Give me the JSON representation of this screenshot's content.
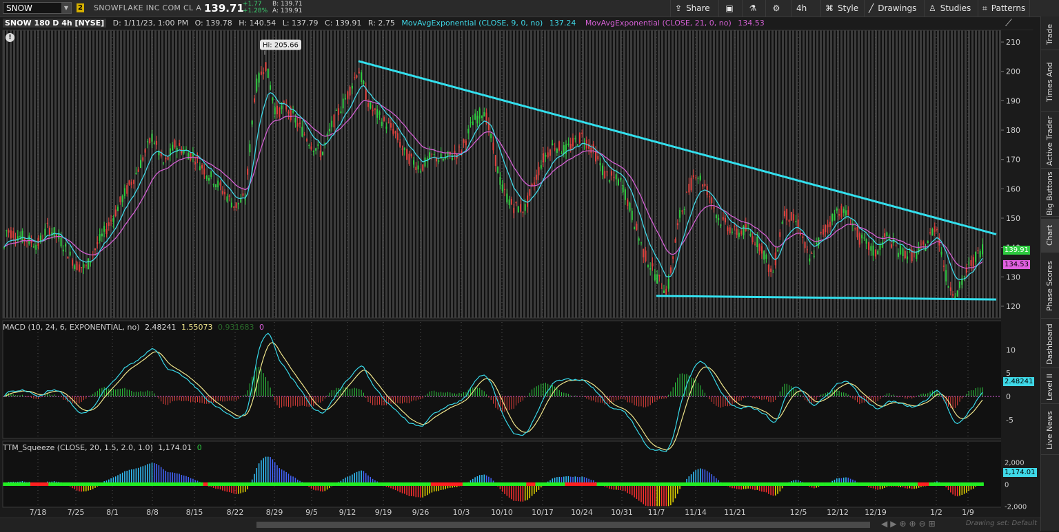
{
  "toolbar": {
    "symbol": "SNOW",
    "link_badge": "2",
    "company": "SNOWFLAKE INC COM CL A",
    "last": "139.71",
    "change": "+1.77",
    "change_pct": "+1.28%",
    "bid": "B: 139.71",
    "ask": "A: 139.91",
    "share": "Share",
    "interval": "4h",
    "style": "Style",
    "drawings": "Drawings",
    "studies": "Studies",
    "patterns": "Patterns"
  },
  "header": {
    "title": "SNOW 180 D 4h [NYSE]",
    "date": "D: 1/11/23, 1:00 PM",
    "open": "O: 139.78",
    "high": "H: 140.54",
    "low": "L: 137.79",
    "close": "C: 139.91",
    "range": "R: 2.75",
    "ema9_label": "MovAvgExponential (CLOSE, 9, 0, no)",
    "ema9_value": "137.24",
    "ema21_label": "MovAvgExponential (CLOSE, 21, 0, no)",
    "ema21_value": "134.53"
  },
  "colors": {
    "ema9": "#3fd9e8",
    "ema21": "#d35fd3",
    "up": "#2ecc40",
    "down": "#e0403c",
    "trendline": "#33e0ee",
    "macd_line": "#38d8e8",
    "signal_line": "#f0e68c",
    "squeeze_on": "#ff2020",
    "squeeze_off": "#22ee22",
    "squeeze_pos": "#4466ff",
    "squeeze_neg": "#e8d800"
  },
  "sidebar": {
    "items": [
      "Trade",
      "Times And Sales",
      "Active Trader",
      "Big Buttons",
      "Chart",
      "Phase Scores",
      "Dashboard",
      "Level II",
      "Live News"
    ]
  },
  "footer": {
    "drawing_set": "Drawing set: Default"
  },
  "chart_data": [
    {
      "type": "candlestick",
      "title": "SNOW 180 D 4h [NYSE]",
      "x_ticks": [
        "7/18",
        "7/25",
        "8/1",
        "8/8",
        "8/15",
        "8/22",
        "8/29",
        "9/5",
        "9/12",
        "9/19",
        "9/26",
        "10/3",
        "10/10",
        "10/17",
        "10/24",
        "10/31",
        "11/7",
        "11/14",
        "11/21",
        "12/5",
        "12/12",
        "12/19",
        "1/2",
        "1/9"
      ],
      "y_ticks": [
        120,
        130,
        140,
        150,
        160,
        170,
        180,
        190,
        200,
        210
      ],
      "ylim": [
        116,
        214
      ],
      "hi_annotation": "Hi: 205.66",
      "last_close": 139.91,
      "ema9_last": 137.24,
      "ema21_last": 134.53,
      "close_path": [
        {
          "date": "7/14",
          "close": 146
        },
        {
          "date": "7/18",
          "close": 141
        },
        {
          "date": "7/20",
          "close": 147
        },
        {
          "date": "7/22",
          "close": 143
        },
        {
          "date": "7/25",
          "close": 134
        },
        {
          "date": "7/27",
          "close": 133
        },
        {
          "date": "7/29",
          "close": 141
        },
        {
          "date": "8/1",
          "close": 150
        },
        {
          "date": "8/3",
          "close": 158
        },
        {
          "date": "8/5",
          "close": 165
        },
        {
          "date": "8/8",
          "close": 178
        },
        {
          "date": "8/10",
          "close": 168
        },
        {
          "date": "8/12",
          "close": 175
        },
        {
          "date": "8/15",
          "close": 171
        },
        {
          "date": "8/17",
          "close": 166
        },
        {
          "date": "8/19",
          "close": 162
        },
        {
          "date": "8/22",
          "close": 154
        },
        {
          "date": "8/24",
          "close": 157
        },
        {
          "date": "8/26",
          "close": 194
        },
        {
          "date": "8/28",
          "close": 203
        },
        {
          "date": "8/30",
          "close": 186
        },
        {
          "date": "9/1",
          "close": 188
        },
        {
          "date": "9/5",
          "close": 175
        },
        {
          "date": "9/7",
          "close": 172
        },
        {
          "date": "9/9",
          "close": 182
        },
        {
          "date": "9/12",
          "close": 192
        },
        {
          "date": "9/14",
          "close": 201
        },
        {
          "date": "9/16",
          "close": 188
        },
        {
          "date": "9/19",
          "close": 183
        },
        {
          "date": "9/21",
          "close": 180
        },
        {
          "date": "9/23",
          "close": 172
        },
        {
          "date": "9/26",
          "close": 167
        },
        {
          "date": "9/28",
          "close": 171
        },
        {
          "date": "9/30",
          "close": 170
        },
        {
          "date": "10/3",
          "close": 173
        },
        {
          "date": "10/5",
          "close": 183
        },
        {
          "date": "10/7",
          "close": 187
        },
        {
          "date": "10/10",
          "close": 160
        },
        {
          "date": "10/12",
          "close": 154
        },
        {
          "date": "10/14",
          "close": 153
        },
        {
          "date": "10/17",
          "close": 170
        },
        {
          "date": "10/19",
          "close": 175
        },
        {
          "date": "10/21",
          "close": 173
        },
        {
          "date": "10/24",
          "close": 178
        },
        {
          "date": "10/26",
          "close": 173
        },
        {
          "date": "10/28",
          "close": 165
        },
        {
          "date": "10/31",
          "close": 162
        },
        {
          "date": "11/2",
          "close": 150
        },
        {
          "date": "11/4",
          "close": 138
        },
        {
          "date": "11/7",
          "close": 130
        },
        {
          "date": "11/9",
          "close": 125
        },
        {
          "date": "11/11",
          "close": 150
        },
        {
          "date": "11/14",
          "close": 166
        },
        {
          "date": "11/16",
          "close": 160
        },
        {
          "date": "11/18",
          "close": 150
        },
        {
          "date": "11/21",
          "close": 145
        },
        {
          "date": "11/23",
          "close": 146
        },
        {
          "date": "11/28",
          "close": 140
        },
        {
          "date": "11/30",
          "close": 130
        },
        {
          "date": "12/2",
          "close": 152
        },
        {
          "date": "12/5",
          "close": 148
        },
        {
          "date": "12/7",
          "close": 135
        },
        {
          "date": "12/9",
          "close": 144
        },
        {
          "date": "12/12",
          "close": 153
        },
        {
          "date": "12/14",
          "close": 151
        },
        {
          "date": "12/16",
          "close": 143
        },
        {
          "date": "12/19",
          "close": 138
        },
        {
          "date": "12/21",
          "close": 144
        },
        {
          "date": "12/23",
          "close": 139
        },
        {
          "date": "12/28",
          "close": 137
        },
        {
          "date": "12/30",
          "close": 141
        },
        {
          "date": "1/2",
          "close": 148
        },
        {
          "date": "1/4",
          "close": 128
        },
        {
          "date": "1/6",
          "close": 124
        },
        {
          "date": "1/9",
          "close": 133
        },
        {
          "date": "1/11",
          "close": 139.91
        }
      ],
      "trendlines": [
        {
          "name": "descending resistance",
          "from": {
            "date": "9/14",
            "price": 203.5
          },
          "to": {
            "date": "1/11",
            "price": 144.5
          }
        },
        {
          "name": "horizontal support",
          "from": {
            "date": "11/7",
            "price": 123.5
          },
          "to": {
            "date": "1/11",
            "price": 122.3
          }
        }
      ]
    },
    {
      "type": "line",
      "title": "MACD (10, 24, 6, EXPONENTIAL, no)",
      "values_shown": [
        "2.48241",
        "1.55073",
        "0.931683",
        "0"
      ],
      "y_ticks": [
        -5,
        0,
        5,
        10
      ],
      "ylim": [
        -9,
        13
      ]
    },
    {
      "type": "histogram",
      "title": "TTM_Squeeze (CLOSE, 20, 1.5, 2.0, 1.0)",
      "values_shown": [
        "1,174.01",
        "0"
      ],
      "y_ticks": [
        "2,000",
        "0",
        "-2,000"
      ],
      "ylim": [
        -2100,
        2600
      ],
      "last_value": "1,174.01"
    }
  ]
}
